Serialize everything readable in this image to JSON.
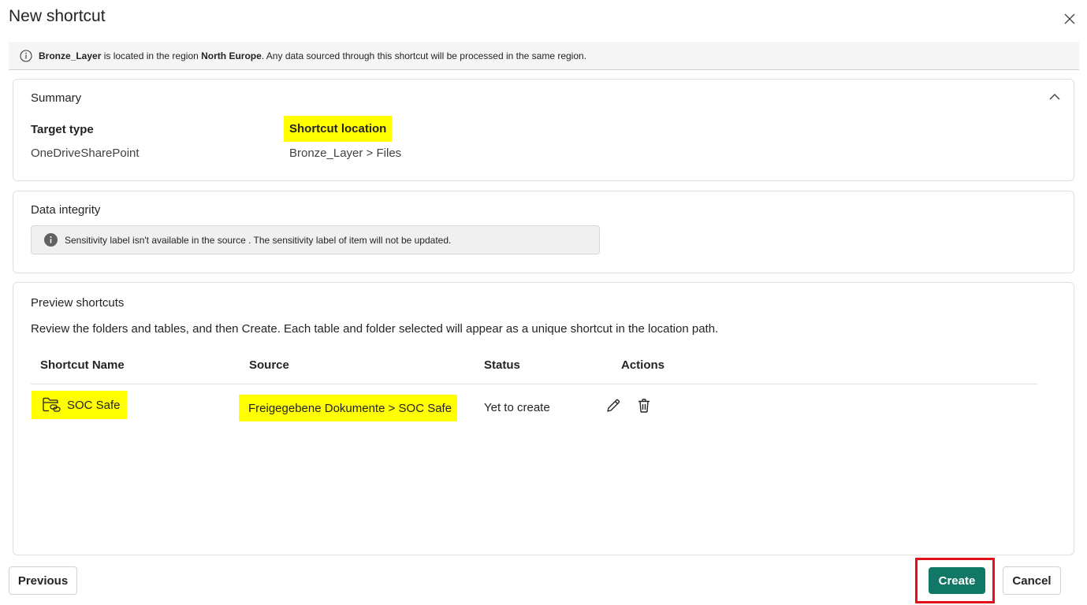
{
  "dialog": {
    "title": "New shortcut",
    "close_icon": "close-icon"
  },
  "infobar": {
    "icon": "info-outline-icon",
    "item_name": "Bronze_Layer",
    "text_1": " is located in the region ",
    "region": "North Europe",
    "text_2": ". Any data sourced through this shortcut will be processed in the same region."
  },
  "summary": {
    "title": "Summary",
    "collapse_icon": "chevron-up-icon",
    "target_type_label": "Target type",
    "target_type_value": "OneDriveSharePoint",
    "location_label": "Shortcut location",
    "location_value": "Bronze_Layer > Files"
  },
  "integrity": {
    "title": "Data integrity",
    "icon": "info-filled-icon",
    "message": "Sensitivity label isn't available in the source . The sensitivity label of item will not be updated."
  },
  "preview": {
    "title": "Preview shortcuts",
    "description": "Review the folders and tables, and then Create. Each table and folder selected will appear as a unique shortcut in the location path.",
    "columns": [
      "Shortcut Name",
      "Source",
      "Status",
      "Actions"
    ],
    "rows": [
      {
        "icon": "folder-link-icon",
        "name": "SOC Safe",
        "source": "Freigegebene Dokumente > SOC Safe",
        "status": "Yet to create",
        "actions": [
          "edit-icon",
          "delete-icon"
        ]
      }
    ]
  },
  "footer": {
    "previous_label": "Previous",
    "create_label": "Create",
    "cancel_label": "Cancel"
  },
  "colors": {
    "primary": "#117865",
    "highlight": "#ffff00",
    "annotation_box": "#e3101a"
  }
}
